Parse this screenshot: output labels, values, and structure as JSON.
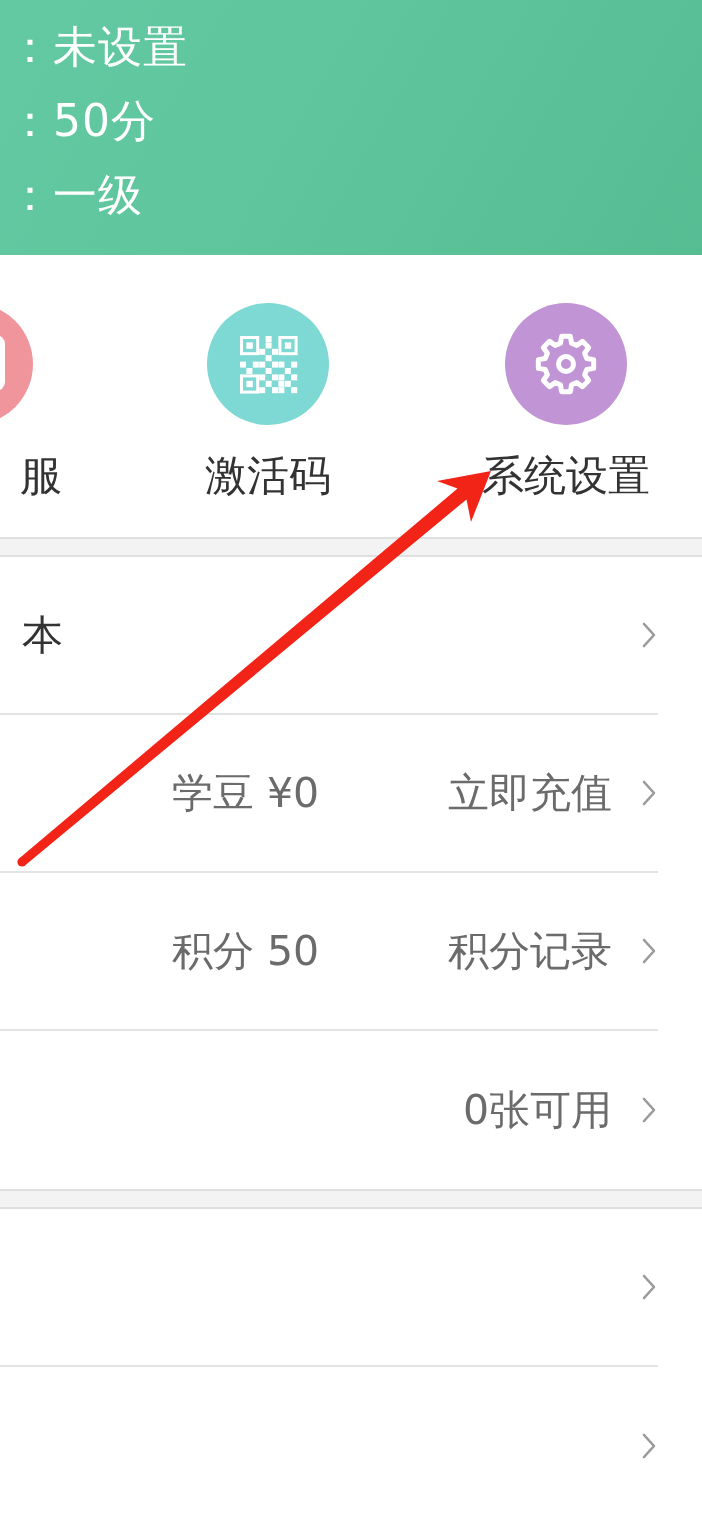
{
  "profile_lines": [
    "：未设置",
    "：50分",
    "：一级"
  ],
  "shortcuts": [
    {
      "kind": "service",
      "label": "服",
      "color": "#f1959c"
    },
    {
      "kind": "code",
      "label": "激活码",
      "color": "#7ed8d3"
    },
    {
      "kind": "settings",
      "label": "系统设置",
      "color": "#c194d5"
    }
  ],
  "menu_sections": [
    {
      "rows": [
        {
          "label": "本",
          "chevron": true
        },
        {
          "info": "学豆 ¥0",
          "action": "立即充值",
          "chevron": true
        },
        {
          "info": "积分 50",
          "action": "积分记录",
          "chevron": true
        },
        {
          "action": "0张可用",
          "chevron": true
        }
      ]
    },
    {
      "rows": [
        {
          "chevron": true
        },
        {
          "chevron": true
        }
      ]
    }
  ],
  "annotation": {
    "kind": "arrow"
  }
}
